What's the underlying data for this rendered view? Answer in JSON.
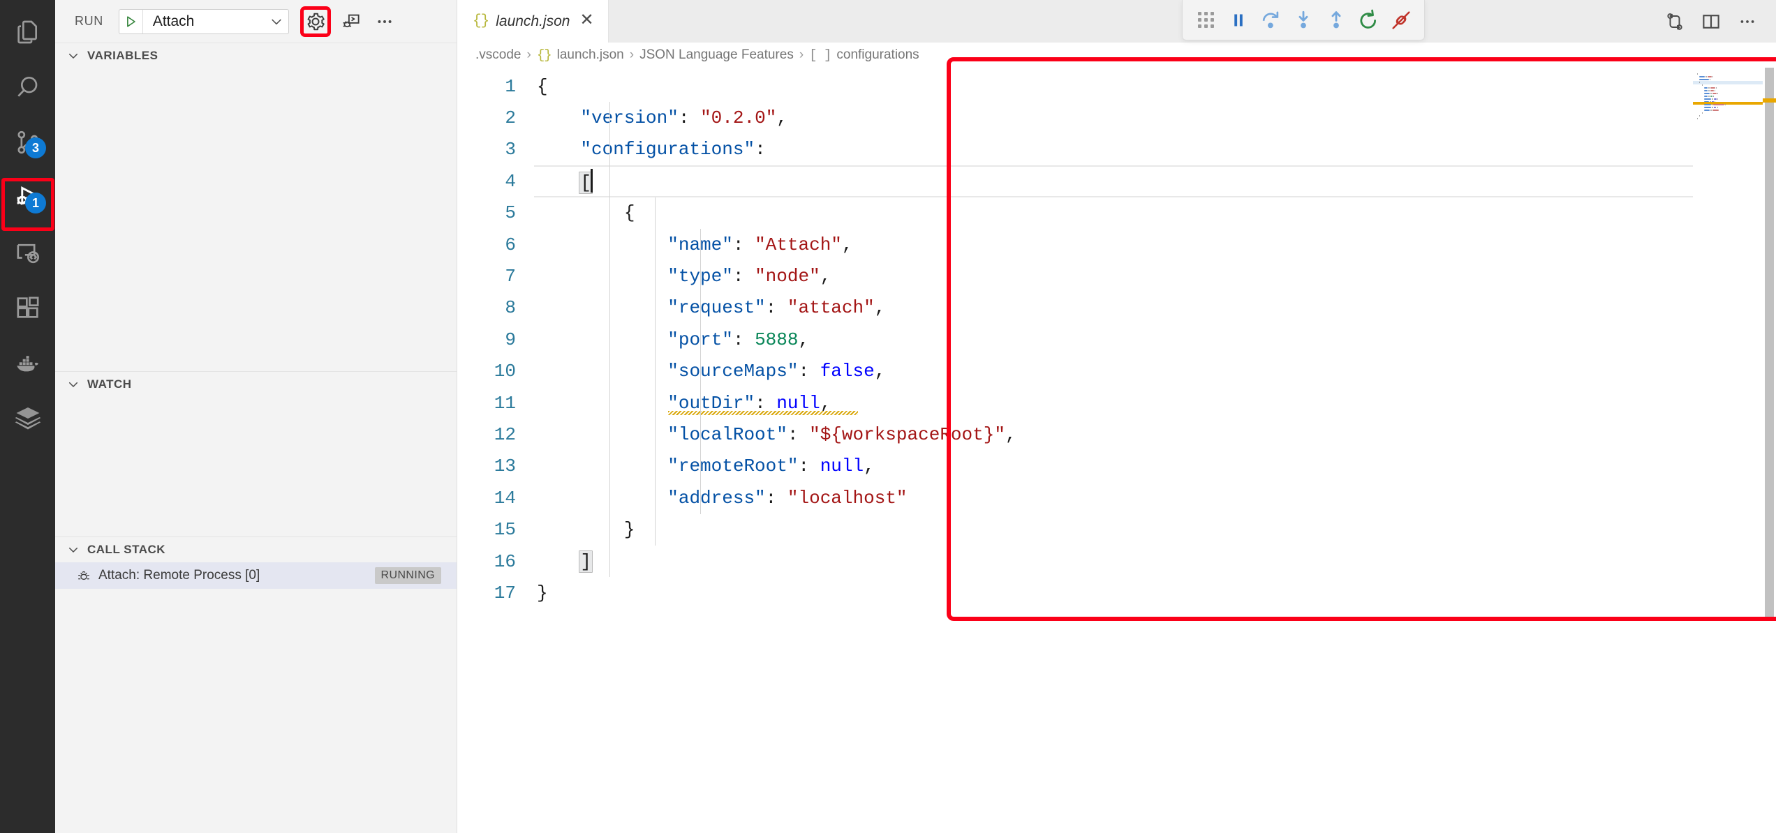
{
  "activity_bar": {
    "items": [
      {
        "name": "explorer",
        "icon": "files-icon",
        "badge": null,
        "active": false
      },
      {
        "name": "search",
        "icon": "search-icon",
        "badge": null,
        "active": false
      },
      {
        "name": "source-control",
        "icon": "source-control-icon",
        "badge": "3",
        "active": false
      },
      {
        "name": "run-and-debug",
        "icon": "run-and-debug-icon",
        "badge": "1",
        "active": true
      },
      {
        "name": "remote-explorer",
        "icon": "remote-explorer-icon",
        "badge": null,
        "active": false
      },
      {
        "name": "extensions",
        "icon": "extensions-icon",
        "badge": null,
        "active": false
      },
      {
        "name": "docker",
        "icon": "docker-icon",
        "badge": null,
        "active": false
      },
      {
        "name": "layers",
        "icon": "layers-icon",
        "badge": null,
        "active": false
      }
    ]
  },
  "sidebar": {
    "title": "RUN",
    "launch_config": {
      "selected": "Attach",
      "start_icon": "play-icon",
      "dropdown_icon": "chevron-down-icon"
    },
    "toolbar": {
      "settings_label": "Open launch.json",
      "settings_icon": "gear-icon",
      "debug_console_icon": "debug-console-icon",
      "more_icon": "ellipsis-icon"
    },
    "sections": [
      {
        "label": "VARIABLES",
        "collapsed": false
      },
      {
        "label": "WATCH",
        "collapsed": false
      },
      {
        "label": "CALL STACK",
        "collapsed": false
      }
    ],
    "call_stack": {
      "rows": [
        {
          "icon": "bug-icon",
          "label": "Attach: Remote Process [0]",
          "state": "RUNNING"
        }
      ]
    }
  },
  "editor": {
    "tabs": [
      {
        "label": "launch.json",
        "icon": "json-icon",
        "close_icon": "close-icon",
        "active": true,
        "dirty": false
      }
    ],
    "actions": [
      {
        "name": "compare-changes",
        "icon": "source-control-compare-icon"
      },
      {
        "name": "split-editor",
        "icon": "split-editor-icon"
      },
      {
        "name": "more-actions",
        "icon": "ellipsis-icon"
      }
    ],
    "breadcrumbs": [
      {
        "label": ".vscode",
        "icon": null
      },
      {
        "label": "launch.json",
        "icon": "json-icon"
      },
      {
        "label": "JSON Language Features",
        "icon": null
      },
      {
        "label": "configurations",
        "icon": "array-icon"
      }
    ],
    "separator": "›",
    "cursor_line": 4,
    "bracket_match_lines": [
      4,
      16
    ],
    "warning_line": 11,
    "lines": [
      {
        "no": "1",
        "tokens": [
          {
            "t": "{",
            "c": "p"
          }
        ]
      },
      {
        "no": "2",
        "tokens": [
          {
            "t": "    ",
            "c": "p"
          },
          {
            "t": "\"version\"",
            "c": "k"
          },
          {
            "t": ": ",
            "c": "p"
          },
          {
            "t": "\"0.2.0\"",
            "c": "s"
          },
          {
            "t": ",",
            "c": "p"
          }
        ]
      },
      {
        "no": "3",
        "tokens": [
          {
            "t": "    ",
            "c": "p"
          },
          {
            "t": "\"configurations\"",
            "c": "k"
          },
          {
            "t": ":",
            "c": "p"
          }
        ]
      },
      {
        "no": "4",
        "tokens": [
          {
            "t": "    ",
            "c": "p"
          },
          {
            "t": "[",
            "c": "p",
            "bracket": true
          },
          {
            "t": "",
            "c": "cursor"
          }
        ]
      },
      {
        "no": "5",
        "tokens": [
          {
            "t": "        ",
            "c": "p"
          },
          {
            "t": "{",
            "c": "p"
          }
        ]
      },
      {
        "no": "6",
        "tokens": [
          {
            "t": "            ",
            "c": "p"
          },
          {
            "t": "\"name\"",
            "c": "k"
          },
          {
            "t": ": ",
            "c": "p"
          },
          {
            "t": "\"Attach\"",
            "c": "s"
          },
          {
            "t": ",",
            "c": "p"
          }
        ]
      },
      {
        "no": "7",
        "tokens": [
          {
            "t": "            ",
            "c": "p"
          },
          {
            "t": "\"type\"",
            "c": "k"
          },
          {
            "t": ": ",
            "c": "p"
          },
          {
            "t": "\"node\"",
            "c": "s"
          },
          {
            "t": ",",
            "c": "p"
          }
        ]
      },
      {
        "no": "8",
        "tokens": [
          {
            "t": "            ",
            "c": "p"
          },
          {
            "t": "\"request\"",
            "c": "k"
          },
          {
            "t": ": ",
            "c": "p"
          },
          {
            "t": "\"attach\"",
            "c": "s"
          },
          {
            "t": ",",
            "c": "p"
          }
        ]
      },
      {
        "no": "9",
        "tokens": [
          {
            "t": "            ",
            "c": "p"
          },
          {
            "t": "\"port\"",
            "c": "k"
          },
          {
            "t": ": ",
            "c": "p"
          },
          {
            "t": "5888",
            "c": "n"
          },
          {
            "t": ",",
            "c": "p"
          }
        ]
      },
      {
        "no": "10",
        "tokens": [
          {
            "t": "            ",
            "c": "p"
          },
          {
            "t": "\"sourceMaps\"",
            "c": "k"
          },
          {
            "t": ": ",
            "c": "p"
          },
          {
            "t": "false",
            "c": "b"
          },
          {
            "t": ",",
            "c": "p"
          }
        ]
      },
      {
        "no": "11",
        "tokens": [
          {
            "t": "            ",
            "c": "p"
          },
          {
            "t": "\"outDir\"",
            "c": "k"
          },
          {
            "t": ": ",
            "c": "p"
          },
          {
            "t": "null",
            "c": "b"
          },
          {
            "t": ",",
            "c": "p"
          }
        ]
      },
      {
        "no": "12",
        "tokens": [
          {
            "t": "            ",
            "c": "p"
          },
          {
            "t": "\"localRoot\"",
            "c": "k"
          },
          {
            "t": ": ",
            "c": "p"
          },
          {
            "t": "\"${workspaceRoot}\"",
            "c": "s"
          },
          {
            "t": ",",
            "c": "p"
          }
        ]
      },
      {
        "no": "13",
        "tokens": [
          {
            "t": "            ",
            "c": "p"
          },
          {
            "t": "\"remoteRoot\"",
            "c": "k"
          },
          {
            "t": ": ",
            "c": "p"
          },
          {
            "t": "null",
            "c": "b"
          },
          {
            "t": ",",
            "c": "p"
          }
        ]
      },
      {
        "no": "14",
        "tokens": [
          {
            "t": "            ",
            "c": "p"
          },
          {
            "t": "\"address\"",
            "c": "k"
          },
          {
            "t": ": ",
            "c": "p"
          },
          {
            "t": "\"localhost\"",
            "c": "s"
          }
        ]
      },
      {
        "no": "15",
        "tokens": [
          {
            "t": "        ",
            "c": "p"
          },
          {
            "t": "}",
            "c": "p"
          }
        ]
      },
      {
        "no": "16",
        "tokens": [
          {
            "t": "    ",
            "c": "p"
          },
          {
            "t": "]",
            "c": "p",
            "bracket": true
          }
        ]
      },
      {
        "no": "17",
        "tokens": [
          {
            "t": "}",
            "c": "p"
          }
        ]
      }
    ]
  },
  "debug_toolbar": {
    "buttons": [
      {
        "name": "drag-handle",
        "icon": "drag-dots-icon",
        "color": "#9a9a9a"
      },
      {
        "name": "pause",
        "icon": "pause-icon",
        "color": "#2a6fc2"
      },
      {
        "name": "step-over",
        "icon": "step-over-icon",
        "color": "#75a8dd"
      },
      {
        "name": "step-into",
        "icon": "step-into-icon",
        "color": "#75a8dd"
      },
      {
        "name": "step-out",
        "icon": "step-out-icon",
        "color": "#75a8dd"
      },
      {
        "name": "restart",
        "icon": "restart-icon",
        "color": "#2e8b45"
      },
      {
        "name": "disconnect",
        "icon": "disconnect-icon",
        "color": "#c0342b"
      }
    ]
  },
  "annotations": {
    "highlight_color": "#fb0018",
    "boxes": [
      {
        "target": "run-and-debug-activity-item"
      },
      {
        "target": "open-launch-json-gear-button"
      },
      {
        "target": "code-editor-region"
      }
    ]
  }
}
